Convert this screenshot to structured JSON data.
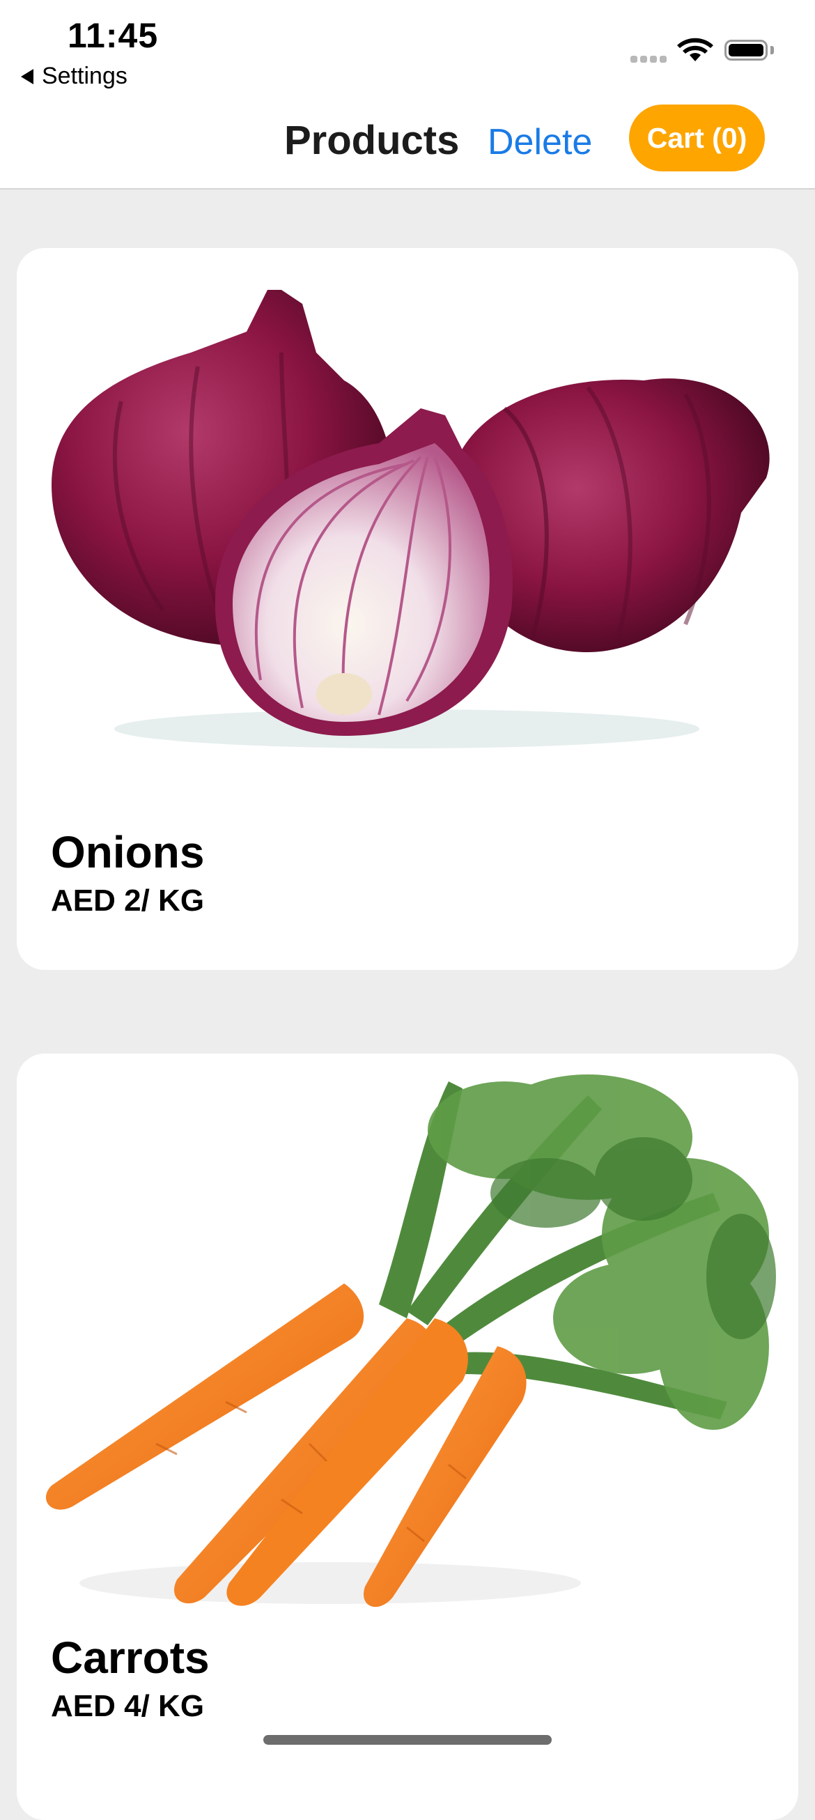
{
  "status_bar": {
    "time": "11:45",
    "back_app_label": "Settings",
    "back_icon": "back-triangle-icon",
    "signal_icon": "cellular-signal-icon",
    "wifi_icon": "wifi-icon",
    "battery_icon": "battery-icon"
  },
  "nav": {
    "title": "Products",
    "delete_label": "Delete",
    "cart_label": "Cart (0)",
    "accent_color": "#1a7be6",
    "cart_color": "#fea500"
  },
  "products": [
    {
      "name": "Onions",
      "price": "AED 2/ KG",
      "image": "red-onions-photo"
    },
    {
      "name": "Carrots",
      "price": "AED 4/ KG",
      "image": "carrots-photo"
    }
  ]
}
